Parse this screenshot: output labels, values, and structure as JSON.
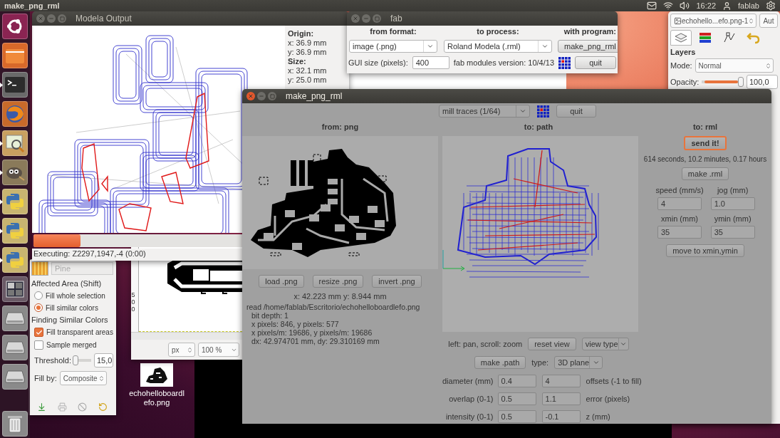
{
  "top_bar": {
    "title": "make_png_rml",
    "time": "16:22",
    "user": "fablab"
  },
  "launcher": [
    {
      "kind": "ubuntu",
      "running": false
    },
    {
      "kind": "files",
      "running": false
    },
    {
      "kind": "terminal",
      "running": true
    },
    {
      "kind": "browser",
      "running": false
    },
    {
      "kind": "viewer",
      "running": true
    },
    {
      "kind": "gimp",
      "running": true
    },
    {
      "kind": "python",
      "running": true
    },
    {
      "kind": "python",
      "running": true
    },
    {
      "kind": "python",
      "running": true
    },
    {
      "kind": "workspaces",
      "running": false
    },
    {
      "kind": "drive",
      "running": false
    },
    {
      "kind": "drive",
      "running": false
    },
    {
      "kind": "drive",
      "running": false
    },
    {
      "kind": "trash",
      "running": false
    }
  ],
  "modela_output": {
    "title": "Modela Output",
    "active": false,
    "info": [
      {
        "heading": "Origin:",
        "lines": [
          "x: 36.9 mm",
          "y: 36.9 mm"
        ]
      },
      {
        "heading": "Size:",
        "lines": [
          "x: 32.1 mm",
          "y: 25.0 mm"
        ]
      }
    ],
    "progress": {
      "level": 0.15
    },
    "status": "Executing: Z2297,1947,-4 (0:00)"
  },
  "fab": {
    "title": "fab",
    "active": false,
    "headers": [
      "from format:",
      "to process:",
      "with program:"
    ],
    "from_format": "image (.png)",
    "to_process": "Roland Modela (.rml)",
    "program_button": "make_png_rml",
    "gui_size_label": "GUI size (pixels):",
    "gui_size": "400",
    "version": "fab modules version: 10/4/13",
    "quit": "quit"
  },
  "gimp_dock": {
    "image": "echohello...efo.png-1",
    "auto": "Aut",
    "tabs": [
      {
        "kind": "layers",
        "selected": true
      },
      {
        "kind": "channels",
        "selected": false
      },
      {
        "kind": "paths",
        "selected": false
      },
      {
        "kind": "undo",
        "selected": false
      }
    ],
    "layers_title": "Layers",
    "mode_label": "Mode:",
    "mode": "Normal",
    "opacity_label": "Opacity:",
    "opacity": {
      "level": 0.93
    },
    "opacity_value": "100,0"
  },
  "gimp_toolbox": {
    "pattern": "Pine",
    "affected_title": "Affected Area  (Shift)",
    "affected_options": [
      {
        "label": "Fill whole selection",
        "selected": false
      },
      {
        "label": "Fill similar colors",
        "selected": true
      }
    ],
    "finding_title": "Finding Similar Colors",
    "checks": [
      {
        "label": "Fill transparent areas",
        "checked": true
      },
      {
        "label": "Sample merged",
        "checked": false
      }
    ],
    "threshold_label": "Threshold:",
    "threshold": {
      "level": 0.1
    },
    "threshold_value": "15,0",
    "fill_by_label": "Fill by:",
    "fill_by": "Composite"
  },
  "gimp_image": {
    "ruler": "500",
    "unit": "px",
    "zoom": "100 %"
  },
  "desktop_file": {
    "label": "echohelloboardlefo.png"
  },
  "make_png_rml": {
    "title": "make_png_rml",
    "active": true,
    "process": "mill traces (1/64)",
    "quit": "quit",
    "from": {
      "heading": "from: png",
      "buttons": [
        "load .png",
        "resize .png",
        "invert .png"
      ],
      "coords": "x: 42.223 mm  y: 8.944 mm",
      "info": {
        "text": "read /home/fablab/Escritorio/echohelloboardlefo.png",
        "children": [
          "bit depth: 1",
          "x pixels: 846, y pixels: 577",
          "x pixels/m: 19686, y pixels/m: 19686",
          "dx: 42.974701 mm, dy: 29.310169 mm"
        ]
      }
    },
    "path": {
      "heading": "to: path",
      "hint": "left: pan, scroll: zoom",
      "reset": "reset view",
      "view_type": "view type",
      "make": "make .path",
      "type_label": "type:",
      "type": "3D plane",
      "params": [
        {
          "label": "diameter (mm)",
          "value": "0.4",
          "value2": "4",
          "label2": "offsets (-1 to fill)"
        },
        {
          "label": "overlap (0-1)",
          "value": "0.5",
          "value2": "1.1",
          "label2": "error (pixels)"
        },
        {
          "label": "intensity (0-1)",
          "value": "0.5",
          "value2": "-0.1",
          "label2": "z (mm)"
        }
      ]
    },
    "rml": {
      "heading": "to: rml",
      "send": "send it!",
      "send_focused": true,
      "estimate": "614 seconds, 10.2 minutes, 0.17 hours",
      "make": "make .rml",
      "fields": [
        {
          "label": "speed (mm/s)",
          "value": "4"
        },
        {
          "label": "jog (mm)",
          "value": "1.0"
        },
        {
          "label": "xmin (mm)",
          "value": "35"
        },
        {
          "label": "ymin (mm)",
          "value": "35"
        }
      ],
      "move": "move to xmin,ymin"
    }
  }
}
